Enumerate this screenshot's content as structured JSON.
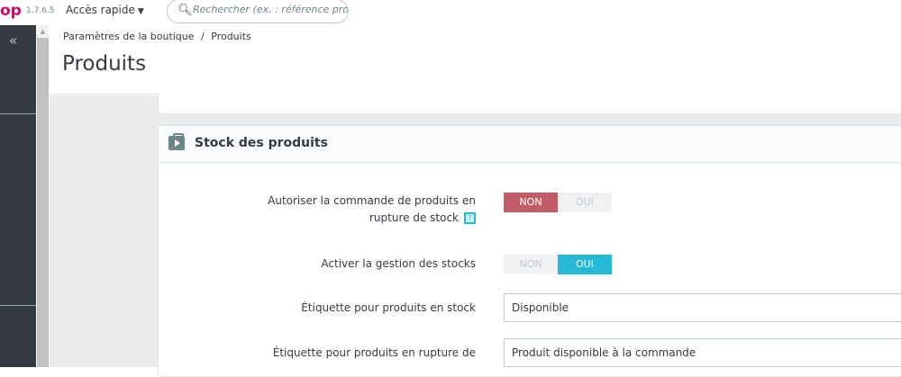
{
  "topbar": {
    "logo": "op",
    "version": "1.7.6.5",
    "quick_access": "Accès rapide",
    "search_placeholder": "Rechercher (ex. : référence produit, nom"
  },
  "sidebar": {
    "collapse": "«"
  },
  "breadcrumb": {
    "parent": "Paramètres de la boutique",
    "sep": "/",
    "current": "Produits"
  },
  "page_title": "Produits",
  "panel": {
    "title": "Stock des produits",
    "allow_oos": {
      "label": "Autoriser la commande de produits en rupture de stock",
      "help": "?",
      "off": "NON",
      "on": "OUI",
      "value": "NON"
    },
    "stock_mgmt": {
      "label": "Activer la gestion des stocks",
      "off": "NON",
      "on": "OUI",
      "value": "OUI"
    },
    "label_in_stock": {
      "label": "Étiquette pour produits en stock",
      "value": "Disponible"
    },
    "label_oos": {
      "label": "Étiquette pour produits en rupture de",
      "value": "Produit disponible à la commande"
    }
  },
  "colors": {
    "accent": "#25b9d7",
    "danger": "#c05c67",
    "sidebar": "#363a41",
    "brand": "#df0067"
  }
}
